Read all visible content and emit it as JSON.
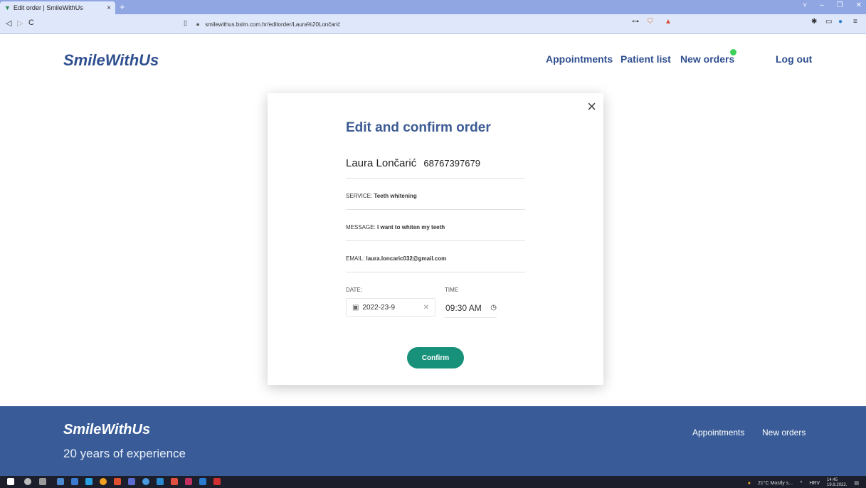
{
  "browser": {
    "tab_title": "Edit order | SmileWithUs",
    "tab_close": "×",
    "new_tab": "+",
    "url": "smilewithus.bslm.com.hr/editorder/Laura%20Lončarić",
    "window_controls": [
      "˅",
      "–",
      "❐",
      "✕"
    ],
    "nav_buttons": [
      "◁",
      "▷",
      "C"
    ]
  },
  "header": {
    "logo": "SmileWithUs",
    "nav": [
      "Appointments",
      "Patient list",
      "New orders"
    ],
    "logout": "Log out",
    "new_orders_indicator_color": "#3ed15a"
  },
  "modal": {
    "title": "Edit and confirm order",
    "patient_name": "Laura Lončarić",
    "patient_id": "68767397679",
    "service_label": "SERVICE:",
    "service_value": "Teeth whitening",
    "message_label": "MESSAGE:",
    "message_value": "I want to whiten my teeth",
    "email_label": "EMAIL:",
    "email_value": "laura.loncaric032@gmail.com",
    "date_label": "DATE:",
    "date_value": "2022-23-9",
    "time_label": "TIME",
    "time_value": "09:30 AM",
    "confirm_label": "Confirm",
    "close_icon": "×"
  },
  "footer": {
    "logo": "SmileWithUs",
    "tagline": "20 years of experience",
    "links": [
      "Appointments",
      "New orders"
    ]
  },
  "taskbar": {
    "weather": "21°C Mostly s...",
    "language": "HRV",
    "time": "14:45",
    "date": "19.9.2022."
  },
  "colors": {
    "brand": "#2f4f8f",
    "footer_bg": "#395c98",
    "confirm_bg": "#18917a"
  }
}
